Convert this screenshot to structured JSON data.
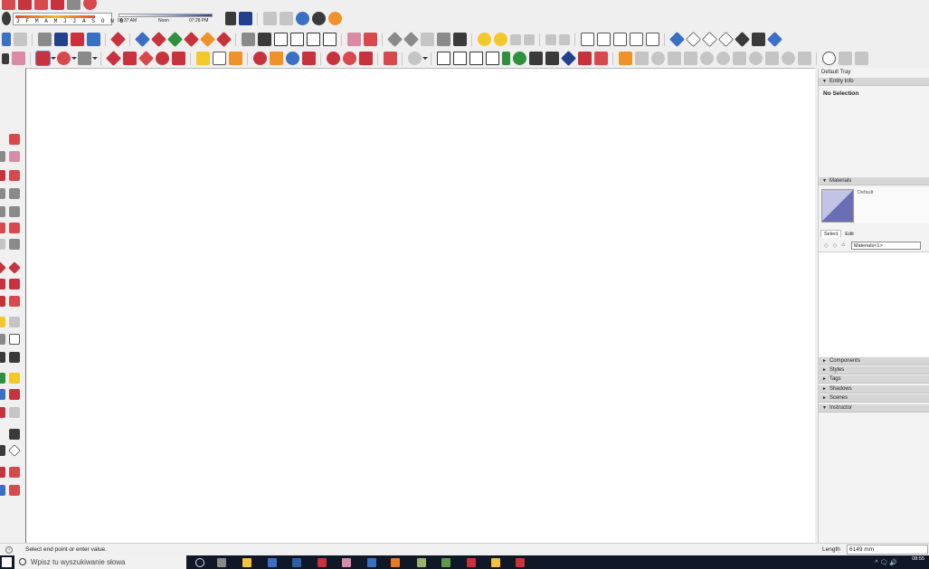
{
  "shadow_toolbar": {
    "months_text": "J F M A M J J A S O N D",
    "time_start": "04:37 AM",
    "time_noon": "Noon",
    "time_end": "07:28 PM"
  },
  "tray": {
    "title": "Default Tray",
    "entity_info": {
      "header": "Entity Info",
      "selection": "No Selection"
    },
    "materials": {
      "header": "Materials",
      "current_material": "Default",
      "tabs": [
        "Select",
        "Edit"
      ],
      "collection_value": "Materials<1>"
    },
    "collapsed_panels": [
      "Components",
      "Styles",
      "Tags",
      "Shadows",
      "Scenes"
    ],
    "instructor": {
      "header": "Instructor"
    }
  },
  "status": {
    "info_glyph": "i",
    "message": "Select end point or enter value.",
    "vcb_label": "Length",
    "vcb_value": "6149 mm"
  },
  "taskbar": {
    "search_placeholder": "Wpisz tu wyszukiwanie słowa",
    "time": "08:55",
    "tray_glyphs": "^ 🗨 🔊"
  },
  "icons": {
    "triangle_open": "▼",
    "triangle_closed": "►",
    "nav_back": "◇",
    "nav_forward": "◇",
    "home": "⌂"
  }
}
